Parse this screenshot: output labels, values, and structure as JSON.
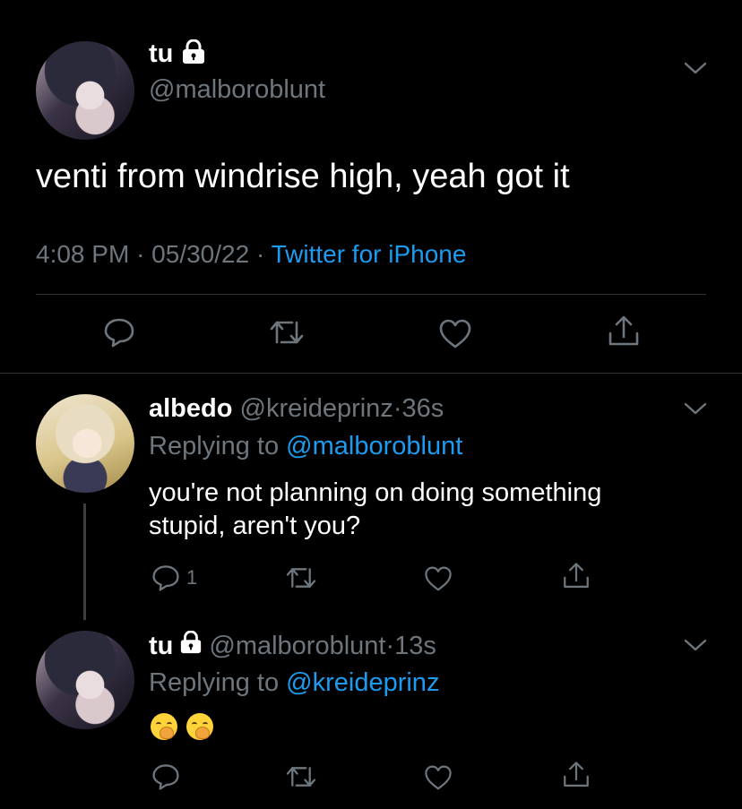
{
  "main_tweet": {
    "display_name": "tu",
    "handle": "@malboroblunt",
    "text": "venti from windrise high, yeah got it",
    "time": "4:08 PM",
    "date": "05/30/22",
    "separator": "·",
    "client": "Twitter for iPhone",
    "icons": [
      "reply-icon",
      "retweet-icon",
      "like-icon",
      "share-icon"
    ]
  },
  "replies": [
    {
      "display_name": "albedo",
      "handle": "@kreideprinz",
      "age": "36s",
      "replying_prefix": "Replying to",
      "replying_to": "@malboroblunt",
      "text_line1": "you're not planning on doing something",
      "text_line2": "stupid, aren't you?",
      "reply_count": "1"
    },
    {
      "display_name": "tu",
      "handle": "@malboroblunt",
      "age": "13s",
      "replying_prefix": "Replying to",
      "replying_to": "@kreideprinz"
    }
  ],
  "colors": {
    "background": "#000000",
    "text": "#ffffff",
    "muted": "#6e767d",
    "link": "#1d9bf0",
    "divider": "#2f3336"
  }
}
